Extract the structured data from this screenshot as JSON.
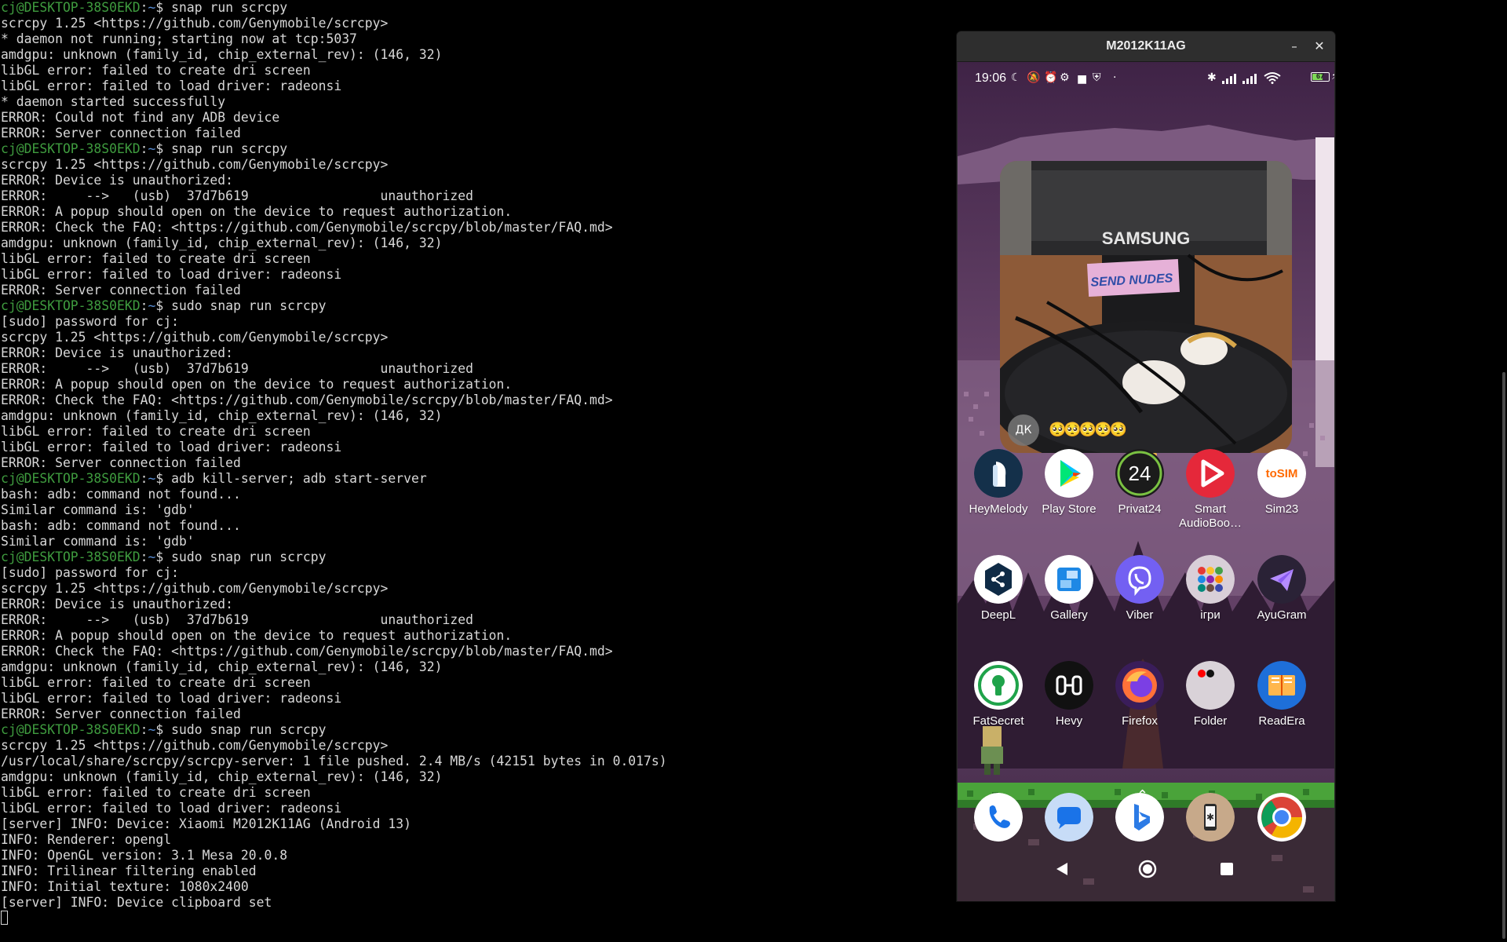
{
  "terminal": {
    "prompt": {
      "user_host": "cj@DESKTOP-38S0EKD",
      "separator": ":",
      "path": "~",
      "symbol": "$ "
    },
    "lines": [
      {
        "type": "prompt",
        "cmd": "snap run scrcpy"
      },
      {
        "type": "out",
        "text": "scrcpy 1.25 <https://github.com/Genymobile/scrcpy>"
      },
      {
        "type": "out",
        "text": "* daemon not running; starting now at tcp:5037"
      },
      {
        "type": "out",
        "text": "amdgpu: unknown (family_id, chip_external_rev): (146, 32)"
      },
      {
        "type": "out",
        "text": "libGL error: failed to create dri screen"
      },
      {
        "type": "out",
        "text": "libGL error: failed to load driver: radeonsi"
      },
      {
        "type": "out",
        "text": "* daemon started successfully"
      },
      {
        "type": "out",
        "text": "ERROR: Could not find any ADB device"
      },
      {
        "type": "out",
        "text": "ERROR: Server connection failed"
      },
      {
        "type": "prompt",
        "cmd": "snap run scrcpy"
      },
      {
        "type": "out",
        "text": "scrcpy 1.25 <https://github.com/Genymobile/scrcpy>"
      },
      {
        "type": "out",
        "text": "ERROR: Device is unauthorized:"
      },
      {
        "type": "out",
        "text": "ERROR:     -->   (usb)  37d7b619                 unauthorized"
      },
      {
        "type": "out",
        "text": "ERROR: A popup should open on the device to request authorization."
      },
      {
        "type": "out",
        "text": "ERROR: Check the FAQ: <https://github.com/Genymobile/scrcpy/blob/master/FAQ.md>"
      },
      {
        "type": "out",
        "text": "amdgpu: unknown (family_id, chip_external_rev): (146, 32)"
      },
      {
        "type": "out",
        "text": "libGL error: failed to create dri screen"
      },
      {
        "type": "out",
        "text": "libGL error: failed to load driver: radeonsi"
      },
      {
        "type": "out",
        "text": "ERROR: Server connection failed"
      },
      {
        "type": "prompt",
        "cmd": "sudo snap run scrcpy"
      },
      {
        "type": "out",
        "text": "[sudo] password for cj:"
      },
      {
        "type": "out",
        "text": "scrcpy 1.25 <https://github.com/Genymobile/scrcpy>"
      },
      {
        "type": "out",
        "text": "ERROR: Device is unauthorized:"
      },
      {
        "type": "out",
        "text": "ERROR:     -->   (usb)  37d7b619                 unauthorized"
      },
      {
        "type": "out",
        "text": "ERROR: A popup should open on the device to request authorization."
      },
      {
        "type": "out",
        "text": "ERROR: Check the FAQ: <https://github.com/Genymobile/scrcpy/blob/master/FAQ.md>"
      },
      {
        "type": "out",
        "text": "amdgpu: unknown (family_id, chip_external_rev): (146, 32)"
      },
      {
        "type": "out",
        "text": "libGL error: failed to create dri screen"
      },
      {
        "type": "out",
        "text": "libGL error: failed to load driver: radeonsi"
      },
      {
        "type": "out",
        "text": "ERROR: Server connection failed"
      },
      {
        "type": "prompt",
        "cmd": "adb kill-server; adb start-server"
      },
      {
        "type": "out",
        "text": "bash: adb: command not found..."
      },
      {
        "type": "out",
        "text": "Similar command is: 'gdb'"
      },
      {
        "type": "out",
        "text": "bash: adb: command not found..."
      },
      {
        "type": "out",
        "text": "Similar command is: 'gdb'"
      },
      {
        "type": "prompt",
        "cmd": "sudo snap run scrcpy"
      },
      {
        "type": "out",
        "text": "[sudo] password for cj:"
      },
      {
        "type": "out",
        "text": "scrcpy 1.25 <https://github.com/Genymobile/scrcpy>"
      },
      {
        "type": "out",
        "text": "ERROR: Device is unauthorized:"
      },
      {
        "type": "out",
        "text": "ERROR:     -->   (usb)  37d7b619                 unauthorized"
      },
      {
        "type": "out",
        "text": "ERROR: A popup should open on the device to request authorization."
      },
      {
        "type": "out",
        "text": "ERROR: Check the FAQ: <https://github.com/Genymobile/scrcpy/blob/master/FAQ.md>"
      },
      {
        "type": "out",
        "text": "amdgpu: unknown (family_id, chip_external_rev): (146, 32)"
      },
      {
        "type": "out",
        "text": "libGL error: failed to create dri screen"
      },
      {
        "type": "out",
        "text": "libGL error: failed to load driver: radeonsi"
      },
      {
        "type": "out",
        "text": "ERROR: Server connection failed"
      },
      {
        "type": "prompt",
        "cmd": "sudo snap run scrcpy"
      },
      {
        "type": "out",
        "text": "scrcpy 1.25 <https://github.com/Genymobile/scrcpy>"
      },
      {
        "type": "out",
        "text": "/usr/local/share/scrcpy/scrcpy-server: 1 file pushed. 2.4 MB/s (42151 bytes in 0.017s)"
      },
      {
        "type": "out",
        "text": "amdgpu: unknown (family_id, chip_external_rev): (146, 32)"
      },
      {
        "type": "out",
        "text": "libGL error: failed to create dri screen"
      },
      {
        "type": "out",
        "text": "libGL error: failed to load driver: radeonsi"
      },
      {
        "type": "out",
        "text": "[server] INFO: Device: Xiaomi M2012K11AG (Android 13)"
      },
      {
        "type": "out",
        "text": "INFO: Renderer: opengl"
      },
      {
        "type": "out",
        "text": "INFO: OpenGL version: 3.1 Mesa 20.0.8"
      },
      {
        "type": "out",
        "text": "INFO: Trilinear filtering enabled"
      },
      {
        "type": "out",
        "text": "INFO: Initial texture: 1080x2400"
      },
      {
        "type": "out",
        "text": "[server] INFO: Device clipboard set"
      }
    ]
  },
  "window": {
    "title": "M2012K11AG",
    "minimize_label": "–",
    "close_label": "✕"
  },
  "phone": {
    "status": {
      "time": "19:06",
      "battery_level": "67",
      "battery_fraction": 0.67
    },
    "widget": {
      "avatar_initials": "ДК",
      "caption": "🥺🥺🥺🥺🥺",
      "photo_brand": "SAMSUNG",
      "photo_sticker": "SEND NUDES"
    },
    "apps": [
      {
        "label": "HeyMelody",
        "icon": "heymelody-icon"
      },
      {
        "label": "Play Store",
        "icon": "play-store-icon"
      },
      {
        "label": "Privat24",
        "icon": "privat24-icon",
        "glyph": "24"
      },
      {
        "label": "Smart AudioBoo…",
        "icon": "smart-audiobook-icon"
      },
      {
        "label": "Sim23",
        "icon": "sim23-icon",
        "glyph": "toSIM"
      },
      {
        "label": "DeepL",
        "icon": "deepl-icon"
      },
      {
        "label": "Gallery",
        "icon": "gallery-icon"
      },
      {
        "label": "Viber",
        "icon": "viber-icon"
      },
      {
        "label": "ігри",
        "icon": "games-folder-icon"
      },
      {
        "label": "AyuGram",
        "icon": "ayugram-icon"
      },
      {
        "label": "FatSecret",
        "icon": "fatsecret-icon"
      },
      {
        "label": "Hevy",
        "icon": "hevy-icon"
      },
      {
        "label": "Firefox",
        "icon": "firefox-icon"
      },
      {
        "label": "Folder",
        "icon": "folder-icon"
      },
      {
        "label": "ReadEra",
        "icon": "readera-icon"
      }
    ],
    "dock": [
      {
        "icon": "phone-icon"
      },
      {
        "icon": "messages-icon"
      },
      {
        "icon": "bing-icon"
      },
      {
        "icon": "device-icon"
      },
      {
        "icon": "chrome-icon"
      }
    ],
    "nav": [
      "back-icon",
      "home-icon",
      "recents-icon"
    ]
  },
  "colors": {
    "terminal_bg": "#000000",
    "terminal_fg": "#d8d8d8",
    "prompt_user": "#3f9c3f",
    "prompt_path": "#5a8fd6",
    "wallpaper_sky": "#45294a",
    "grass": "#4aa33a"
  }
}
